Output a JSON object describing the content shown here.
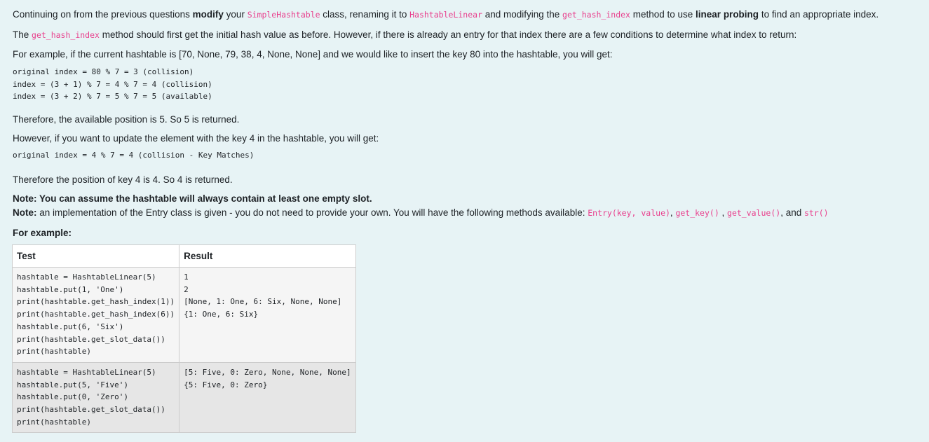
{
  "paragraph1": {
    "t1": "Continuing on from the previous questions ",
    "b1": "modify",
    "t2": " your ",
    "c1": "SimpleHashtable",
    "t3": " class, renaming it to ",
    "c2": "HashtableLinear",
    "t4": " and modifying the ",
    "c3": "get_hash_index",
    "t5": " method to use ",
    "b2": "linear probing",
    "t6": " to find an appropriate index."
  },
  "paragraph2": {
    "t1": "The ",
    "c1": "get_hash_index",
    "t2": " method should first get the initial hash value as before. However, if there is already an entry for that index there are a few conditions to determine what index to return:"
  },
  "paragraph3": "For example, if the current hashtable is [70, None, 79, 38, 4, None, None] and we would like to insert the key 80 into the hashtable, you will get:",
  "example1_code": "original index = 80 % 7 = 3 (collision)\nindex = (3 + 1) % 7 = 4 % 7 = 4 (collision)\nindex = (3 + 2) % 7 = 5 % 7 = 5 (available)",
  "paragraph4": "Therefore, the available position is 5. So 5 is returned.",
  "paragraph5": "However, if you want to update the element with the key 4 in the hashtable, you will get:",
  "example2_code": "original index = 4 % 7 = 4 (collision - Key Matches)",
  "paragraph6": "Therefore the position of key 4 is 4. So 4 is returned.",
  "note1": "Note: You can assume the hashtable will always contain at least one empty slot.",
  "note2": {
    "label": "Note:",
    "t1": "  an implementation of the Entry class is given - you do not need to provide your own. You will have the following methods available: ",
    "c1": "Entry(key, value)",
    "t2": ", ",
    "c2": "get_key()",
    "t3": " , ",
    "c3": "get_value()",
    "t4": ", and ",
    "c4": "str()"
  },
  "for_example_label": "For example:",
  "table": {
    "headers": [
      "Test",
      "Result"
    ],
    "rows": [
      {
        "test": "hashtable = HashtableLinear(5)\nhashtable.put(1, 'One')\nprint(hashtable.get_hash_index(1))\nprint(hashtable.get_hash_index(6))\nhashtable.put(6, 'Six')\nprint(hashtable.get_slot_data())\nprint(hashtable)",
        "result": "1\n2\n[None, 1: One, 6: Six, None, None]\n{1: One, 6: Six}"
      },
      {
        "test": "hashtable = HashtableLinear(5)\nhashtable.put(5, 'Five')\nhashtable.put(0, 'Zero')\nprint(hashtable.get_slot_data())\nprint(hashtable)",
        "result": "[5: Five, 0: Zero, None, None, None]\n{5: Five, 0: Zero}"
      }
    ]
  },
  "colors": {
    "background": "#e7f3f5",
    "code_pink": "#e83e8c",
    "row_odd": "#f5f5f5",
    "row_even": "#e6e6e6"
  }
}
